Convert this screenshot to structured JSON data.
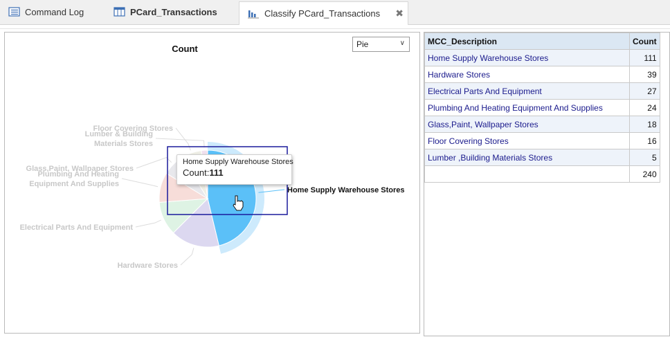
{
  "tabs": [
    {
      "label": "Command Log",
      "icon": "command-log-icon",
      "bold": false,
      "active": false
    },
    {
      "label": "PCard_Transactions",
      "icon": "table-icon",
      "bold": true,
      "active": false
    },
    {
      "label": "Classify PCard_Transactions",
      "icon": "classify-chart-icon",
      "bold": false,
      "active": true
    }
  ],
  "chart": {
    "select_value": "Pie"
  },
  "chart_data": {
    "type": "pie",
    "title": "Count",
    "categories": [
      "Home Supply Warehouse Stores",
      "Hardware Stores",
      "Electrical Parts And Equipment",
      "Plumbing And Heating Equipment And Supplies",
      "Glass,Paint, Wallpaper Stores",
      "Floor Covering Stores",
      "Lumber & Building Materials Stores"
    ],
    "values": [
      111,
      39,
      27,
      24,
      18,
      16,
      5
    ],
    "slice_labels": [
      [
        "Home Supply Warehouse Stores"
      ],
      [
        "Hardware Stores"
      ],
      [
        "Electrical Parts And Equipment"
      ],
      [
        "Plumbing And Heating",
        "Equipment And Supplies"
      ],
      [
        "Glass,Paint, Wallpaper Stores"
      ],
      [
        "Floor Covering Stores"
      ],
      [
        "Lumber & Building",
        "Materials Stores"
      ]
    ],
    "colors": [
      "#5bc0f8",
      "#dcd8f0",
      "#def3e4",
      "#f7ddd9",
      "#e8e8ec",
      "#efefe6",
      "#f1e1ef"
    ],
    "highlighted": "Home Supply Warehouse Stores",
    "tooltip": {
      "title": "Home Supply Warehouse Stores",
      "count_label": "Count:",
      "count_value": "111"
    }
  },
  "table": {
    "headers": [
      "MCC_Description",
      "Count"
    ],
    "rows": [
      [
        "Home Supply Warehouse Stores",
        "111"
      ],
      [
        "Hardware Stores",
        "39"
      ],
      [
        "Electrical Parts And Equipment",
        "27"
      ],
      [
        "Plumbing And Heating Equipment And Supplies",
        "24"
      ],
      [
        "Glass,Paint, Wallpaper Stores",
        "18"
      ],
      [
        "Floor Covering Stores",
        "16"
      ],
      [
        "Lumber ,Building Materials Stores",
        "5"
      ]
    ],
    "total": "240"
  }
}
